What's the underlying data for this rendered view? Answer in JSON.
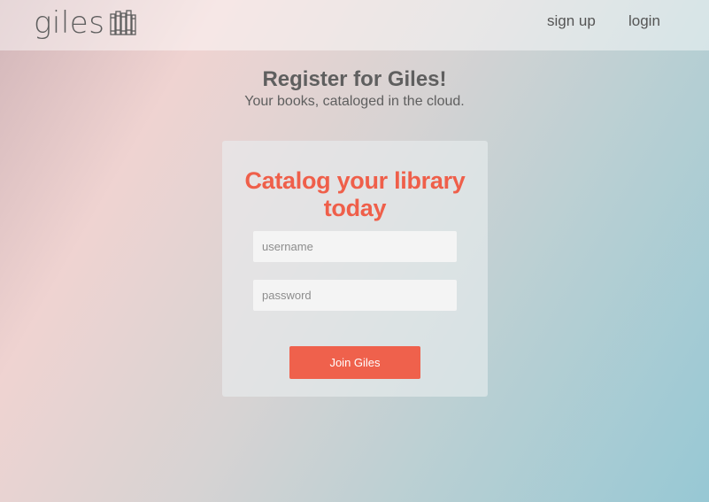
{
  "header": {
    "brand": "giles",
    "brand_icon": "bookshelf-icon",
    "nav": {
      "signup": "sign up",
      "login": "login"
    }
  },
  "main": {
    "title": "Register for Giles!",
    "subtitle": "Your books, cataloged in the cloud."
  },
  "form": {
    "title": "Catalog your library today",
    "username_placeholder": "username",
    "password_placeholder": "password",
    "submit_label": "Join Giles"
  },
  "colors": {
    "accent": "#ef614c",
    "text": "#5f5f5f"
  }
}
